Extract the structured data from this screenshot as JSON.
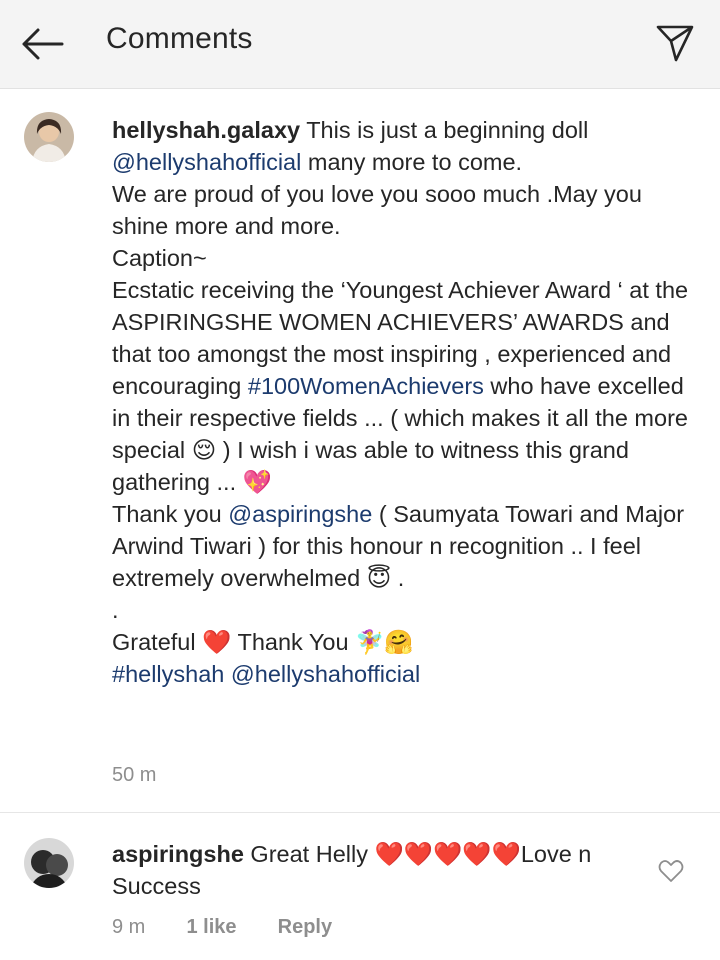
{
  "header": {
    "title": "Comments"
  },
  "caption": {
    "username": "hellyshah.galaxy",
    "text_parts": [
      {
        "type": "text",
        "value": " This is just a beginning doll\n"
      },
      {
        "type": "link",
        "value": "@hellyshahofficial"
      },
      {
        "type": "text",
        "value": " many more to come.\nWe are proud of you love you sooo much .May you shine more and more.\nCaption~\nEcstatic receiving the ‘Youngest Achiever Award ‘ at the ASPIRINGSHE WOMEN ACHIEVERS’ AWARDS and that too amongst the most inspiring , experienced and encouraging "
      },
      {
        "type": "link",
        "value": "#100WomenAchievers"
      },
      {
        "type": "text",
        "value": " who have excelled in their respective fields ... ( which makes it all the more special "
      },
      {
        "type": "emoji",
        "value": "😌"
      },
      {
        "type": "text",
        "value": " ) I wish i was able to witness this grand gathering ... "
      },
      {
        "type": "emoji",
        "value": "💖"
      },
      {
        "type": "text",
        "value": "\nThank you "
      },
      {
        "type": "link",
        "value": "@aspiringshe"
      },
      {
        "type": "text",
        "value": " ( Saumyata Towari and Major Arwind Tiwari ) for this honour n recognition .. I feel extremely overwhelmed "
      },
      {
        "type": "emoji",
        "value": "😇"
      },
      {
        "type": "text",
        "value": " .\n.\nGrateful "
      },
      {
        "type": "emoji",
        "value": "❤️"
      },
      {
        "type": "text",
        "value": " Thank You "
      },
      {
        "type": "emoji",
        "value": "🧚‍♀️🤗"
      },
      {
        "type": "text",
        "value": "\n"
      },
      {
        "type": "link",
        "value": "#hellyshah"
      },
      {
        "type": "text",
        "value": " "
      },
      {
        "type": "link",
        "value": "@hellyshahofficial"
      }
    ],
    "time": "50 m"
  },
  "comment": {
    "username": "aspiringshe",
    "text_parts": [
      {
        "type": "text",
        "value": " Great Helly "
      },
      {
        "type": "emoji",
        "value": "❤️❤️❤️❤️❤️"
      },
      {
        "type": "text",
        "value": "Love n Success"
      }
    ],
    "time": "9 m",
    "likes": "1 like",
    "reply": "Reply"
  },
  "icons": {
    "back": "back-arrow-icon",
    "send": "send-icon",
    "like": "heart-outline-icon"
  },
  "colors": {
    "link": "#1c3b6e",
    "meta": "#8e8e8e",
    "header_bg": "#f4f4f4"
  }
}
